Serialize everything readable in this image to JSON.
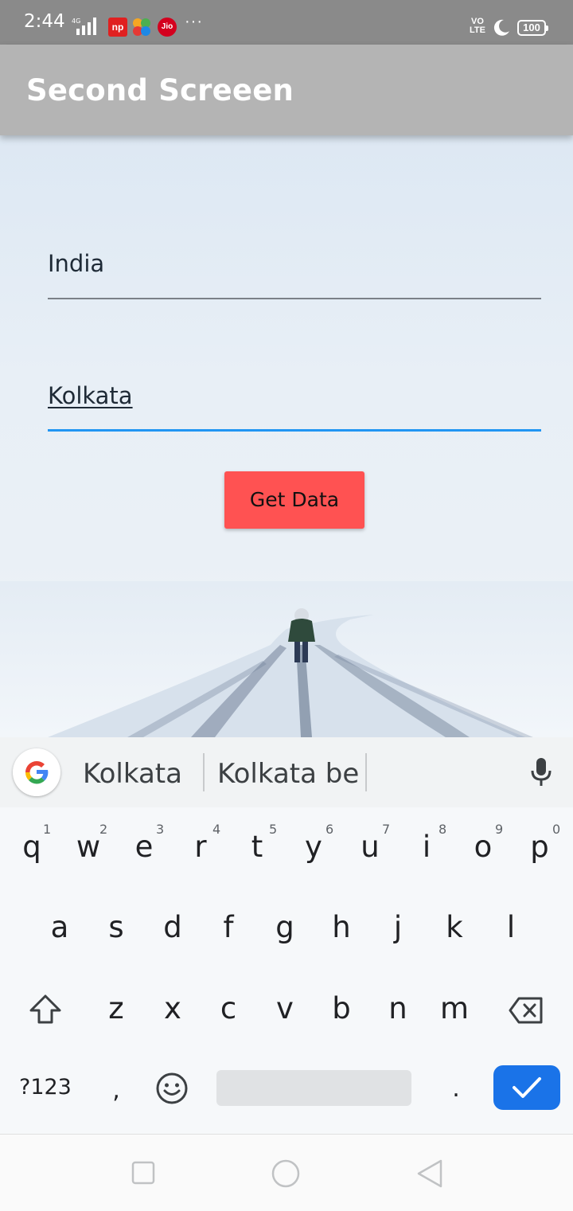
{
  "status_bar": {
    "time": "2:44",
    "network": "4G",
    "app_np": "np",
    "app_jio": "Jio",
    "more": "···",
    "volte_top": "VO",
    "volte_bottom": "LTE",
    "battery": "100"
  },
  "app_bar": {
    "title": "Second Screeen"
  },
  "form": {
    "country_value": "India",
    "city_value": "Kolkata",
    "button_label": "Get Data"
  },
  "keyboard": {
    "suggestions": [
      "Kolkata",
      "Kolkata be"
    ],
    "row1": [
      "q",
      "w",
      "e",
      "r",
      "t",
      "y",
      "u",
      "i",
      "o",
      "p"
    ],
    "row1_hints": [
      "1",
      "2",
      "3",
      "4",
      "5",
      "6",
      "7",
      "8",
      "9",
      "0"
    ],
    "row2": [
      "a",
      "s",
      "d",
      "f",
      "g",
      "h",
      "j",
      "k",
      "l"
    ],
    "row3": [
      "z",
      "x",
      "c",
      "v",
      "b",
      "n",
      "m"
    ],
    "symbols_label": "?123",
    "comma": ",",
    "period": "."
  },
  "colors": {
    "button": "#ff5252",
    "focus_line": "#2196f3",
    "enter_key": "#1a73e8"
  }
}
